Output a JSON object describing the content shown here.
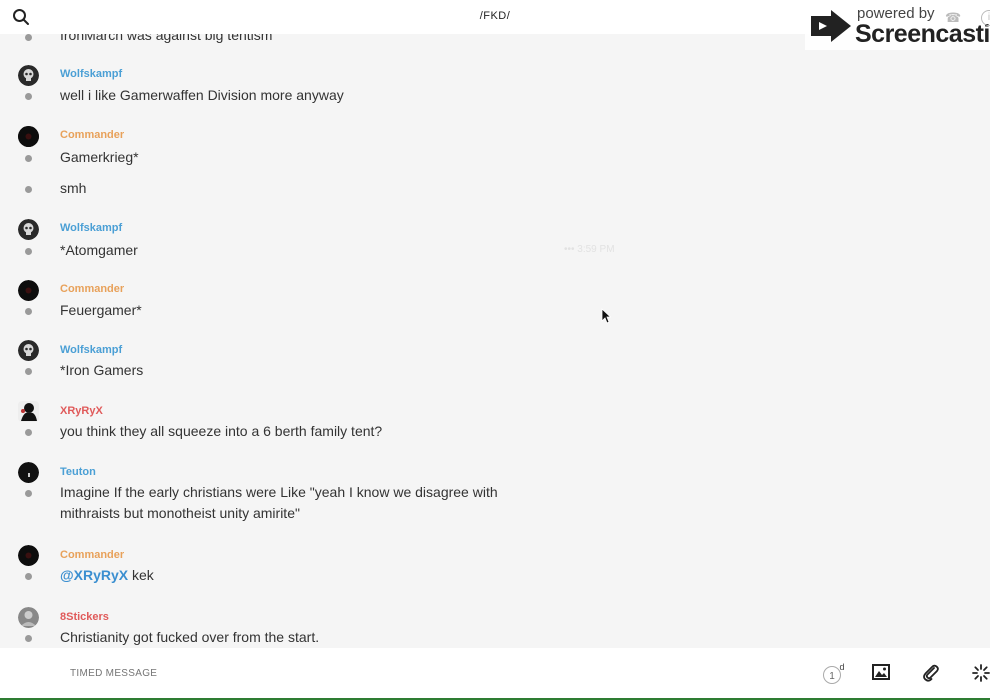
{
  "header": {
    "channel": "/FKD/",
    "watermark": {
      "powered": "powered by",
      "brand": "Screencastify"
    }
  },
  "messages": {
    "partial_top_text": "IronMarch was against big tentism",
    "groups": [
      {
        "author": "Wolfskampf",
        "author_color": "#4a9fd5",
        "avatar": "skull",
        "lines": [
          "well i like Gamerwaffen Division more anyway"
        ]
      },
      {
        "author": "Commander",
        "author_color": "#e8a15a",
        "avatar": "dark",
        "lines": [
          "Gamerkrieg*",
          "smh"
        ]
      },
      {
        "author": "Wolfskampf",
        "author_color": "#4a9fd5",
        "avatar": "skull",
        "lines": [
          "*Atomgamer"
        ]
      },
      {
        "author": "Commander",
        "author_color": "#e8a15a",
        "avatar": "dark",
        "lines": [
          "Feuergamer*"
        ]
      },
      {
        "author": "Wolfskampf",
        "author_color": "#4a9fd5",
        "avatar": "skull",
        "lines": [
          "*Iron Gamers"
        ]
      },
      {
        "author": "XRyRyX",
        "author_color": "#e05a5a",
        "avatar": "figure",
        "lines": [
          "you think they all squeeze into a 6 berth family tent?"
        ]
      },
      {
        "author": "Teuton",
        "author_color": "#4a9fd5",
        "avatar": "dark-small",
        "lines": [
          "Imagine If the early christians were Like \"yeah I know we disagree with mithraists but monotheist unity amirite\""
        ]
      },
      {
        "author": "Commander",
        "author_color": "#e8a15a",
        "avatar": "dark",
        "mention": "@XRyRyX",
        "lines": [
          " kek"
        ]
      },
      {
        "author": "8Stickers",
        "author_color": "#e05a5a",
        "avatar": "photo",
        "lines": [
          "Christianity got fucked over from the start."
        ]
      }
    ],
    "hover_time": "•••  3:59 PM"
  },
  "composer": {
    "placeholder": "TIMED MESSAGE",
    "timer_value": "1",
    "timer_unit": "d"
  },
  "icons": [
    "search-icon",
    "image-icon",
    "paperclip-icon",
    "loader-icon",
    "timer-icon",
    "phone-icon",
    "info-icon"
  ]
}
